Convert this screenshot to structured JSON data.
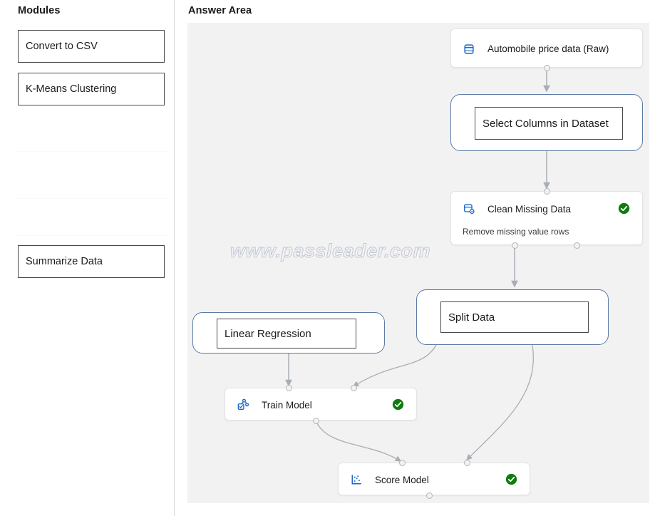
{
  "modules_panel": {
    "title": "Modules",
    "items": [
      {
        "label": "Convert to CSV"
      },
      {
        "label": "K-Means Clustering"
      },
      {
        "label": "Summarize Data"
      }
    ]
  },
  "answer_area": {
    "title": "Answer Area",
    "watermark": "www.passleader.com",
    "colors": {
      "canvas_background": "#f2f2f2",
      "slot_border": "#5b7aa6",
      "answer_box_border": "#4a4a4a",
      "icon_blue": "#1667c9",
      "status_green": "#107c10",
      "edge_gray": "#a9aeb5"
    },
    "nodes": [
      {
        "id": "automobile-price-data-raw",
        "title": "Automobile price data (Raw)",
        "subtitle": "",
        "icon": "database-icon",
        "status": "",
        "kind": "card"
      },
      {
        "id": "select-columns-in-dataset",
        "title": "Select Columns in Dataset",
        "subtitle": "",
        "icon": "",
        "status": "",
        "kind": "slot"
      },
      {
        "id": "clean-missing-data",
        "title": "Clean Missing Data",
        "subtitle": "Remove missing value rows",
        "icon": "clean-data-icon",
        "status": "success-check-icon",
        "kind": "card"
      },
      {
        "id": "split-data",
        "title": "Split Data",
        "subtitle": "",
        "icon": "",
        "status": "",
        "kind": "slot"
      },
      {
        "id": "linear-regression",
        "title": "Linear Regression",
        "subtitle": "",
        "icon": "",
        "status": "",
        "kind": "slot"
      },
      {
        "id": "train-model",
        "title": "Train Model",
        "subtitle": "",
        "icon": "train-model-icon",
        "status": "success-check-icon",
        "kind": "card"
      },
      {
        "id": "score-model",
        "title": "Score Model",
        "subtitle": "",
        "icon": "score-model-icon",
        "status": "success-check-icon",
        "kind": "card"
      }
    ]
  }
}
